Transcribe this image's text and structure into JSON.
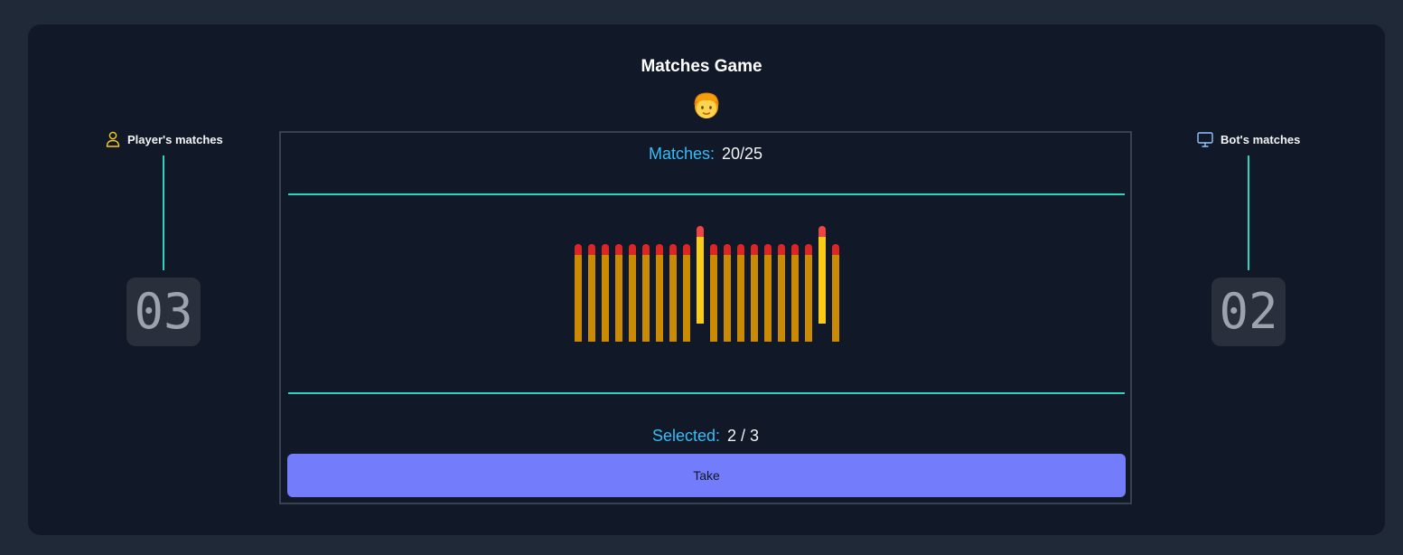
{
  "title": "Matches Game",
  "avatar_icon": "player-face-emoji",
  "player": {
    "label": "Player's matches",
    "count": "03",
    "icon": "user-icon",
    "icon_color": "#facc15"
  },
  "bot": {
    "label": "Bot's matches",
    "count": "02",
    "icon": "monitor-icon",
    "icon_color": "#93c5fd"
  },
  "matches_stat": {
    "label": "Matches:",
    "value": "20/25"
  },
  "board": {
    "total_matches": 20,
    "selected_indices": [
      9,
      18
    ]
  },
  "selected_stat": {
    "label": "Selected:",
    "value": "2 / 3"
  },
  "take_button": {
    "label": "Take"
  },
  "colors": {
    "accent_line": "#2dd4bf",
    "stat_label": "#38bdf8",
    "button": "#737cfb",
    "match_head": "#dc2626",
    "match_stick": "#ca8a04",
    "match_selected": "#facc15"
  }
}
